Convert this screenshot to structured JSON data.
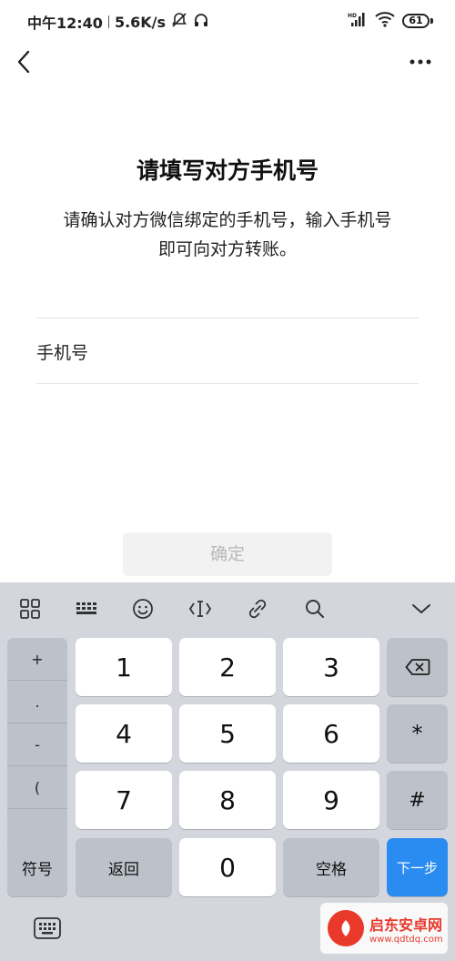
{
  "status_bar": {
    "time": "中午12:40",
    "speed": "5.6K/s",
    "battery": "61",
    "network_label": "HD"
  },
  "page": {
    "title": "请填写对方手机号",
    "subtitle_line1": "请确认对方微信绑定的手机号，输入手机号",
    "subtitle_line2": "即可向对方转账。",
    "phone_label": "手机号",
    "phone_value": "",
    "confirm_label": "确定"
  },
  "keyboard": {
    "symbols": [
      "+",
      ".",
      "-",
      "("
    ],
    "digits": [
      "1",
      "2",
      "3",
      "4",
      "5",
      "6",
      "7",
      "8",
      "9",
      "0"
    ],
    "star": "*",
    "hash": "#",
    "symbol_key": "符号",
    "return_key": "返回",
    "space_key": "空格",
    "next_key": "下一步"
  },
  "watermark": {
    "title": "启东安卓网",
    "url": "www.qdtdq.com"
  },
  "colors": {
    "keyboard_bg": "#d3d7dd",
    "key_bg": "#ffffff",
    "func_key_bg": "#bdc2ca",
    "next_key_bg": "#2a8cf0",
    "confirm_disabled_bg": "#f2f2f2"
  }
}
